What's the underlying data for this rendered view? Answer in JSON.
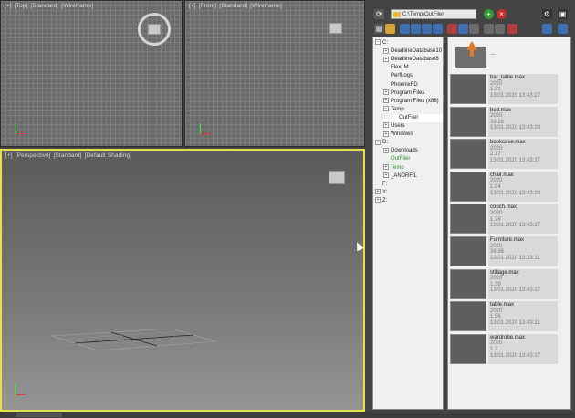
{
  "viewports": {
    "top": {
      "plus": "[+]",
      "view": "[Top]",
      "mode": "[Standard]",
      "shading": "[Wireframe]"
    },
    "front": {
      "plus": "[+]",
      "view": "[Front]",
      "mode": "[Standard]",
      "shading": "[Wireframe]"
    },
    "perspective": {
      "plus": "[+]",
      "view": "[Perspective]",
      "mode": "[Standard]",
      "shading": "[Default Shading]"
    }
  },
  "browser": {
    "path": "C:\\Temp\\OutFiler",
    "up_label": "...",
    "tree": [
      {
        "label": "C:",
        "expander": "−",
        "level": 0
      },
      {
        "label": "DeadlineDatabase10",
        "expander": "+",
        "level": 1
      },
      {
        "label": "DeadlineDatabase8",
        "expander": "+",
        "level": 1
      },
      {
        "label": "FlexLM",
        "expander": "",
        "level": 1
      },
      {
        "label": "PerfLogs",
        "expander": "",
        "level": 1
      },
      {
        "label": "PhoenixFD",
        "expander": "",
        "level": 1
      },
      {
        "label": "Program Files",
        "expander": "+",
        "level": 1
      },
      {
        "label": "Program Files (x86)",
        "expander": "+",
        "level": 1
      },
      {
        "label": "Temp",
        "expander": "−",
        "level": 1
      },
      {
        "label": "OutFiler",
        "expander": "",
        "level": 2,
        "selected": true
      },
      {
        "label": "Users",
        "expander": "+",
        "level": 1
      },
      {
        "label": "Windows",
        "expander": "+",
        "level": 1
      },
      {
        "label": "D:",
        "expander": "−",
        "level": 0
      },
      {
        "label": "Downloads",
        "expander": "+",
        "level": 1
      },
      {
        "label": "OutFiler",
        "expander": "",
        "level": 1,
        "green": true
      },
      {
        "label": "Temp",
        "expander": "+",
        "level": 1,
        "green": true
      },
      {
        "label": "_ANDRFIL",
        "expander": "+",
        "level": 1
      },
      {
        "label": "F:",
        "expander": "",
        "level": 0
      },
      {
        "label": "Y:",
        "expander": "+",
        "level": 0
      },
      {
        "label": "Z:",
        "expander": "+",
        "level": 0
      }
    ],
    "files": [
      {
        "name": "bar_table.max",
        "version": "2020",
        "size": "1.31",
        "date": "13.01.2020 13:43:27"
      },
      {
        "name": "bed.max",
        "version": "2020",
        "size": "33.26",
        "date": "13.01.2020 13:43:28"
      },
      {
        "name": "bookcase.max",
        "version": "2020",
        "size": "2.17",
        "date": "13.01.2020 13:43:27"
      },
      {
        "name": "chair.max",
        "version": "2020",
        "size": "1.94",
        "date": "13.01.2020 13:43:28"
      },
      {
        "name": "couch.max",
        "version": "2020",
        "size": "1.78",
        "date": "13.01.2020 13:43:27"
      },
      {
        "name": "Furniture.max",
        "version": "2020",
        "size": "36.36",
        "date": "13.01.2020 13:33:11"
      },
      {
        "name": "stillage.max",
        "version": "2020",
        "size": "1.39",
        "date": "13.01.2020 13:43:27"
      },
      {
        "name": "table.max",
        "version": "2020",
        "size": "1.56",
        "date": "13.01.2020 13:43:21"
      },
      {
        "name": "wardrobe.max",
        "version": "2020",
        "size": "1.2",
        "date": "13.01.2020 13:43:17"
      }
    ]
  },
  "icons": [
    "refresh-icon",
    "folder-icon",
    "add-icon",
    "close-icon",
    "settings-icon",
    "pin-icon"
  ],
  "colors": {
    "active_viewport_border": "#e6e04c",
    "add_green": "#3a9a3a",
    "close_red": "#c03030",
    "tree_green": "#2f8f2f"
  }
}
